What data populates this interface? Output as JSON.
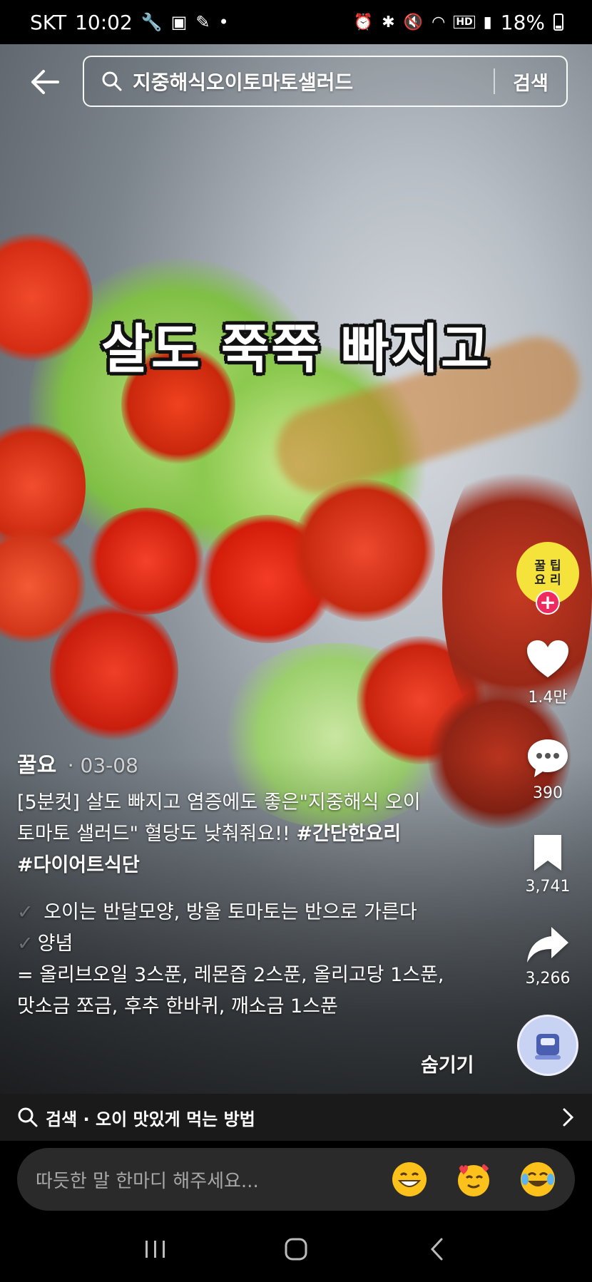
{
  "status_bar": {
    "carrier": "SKT",
    "time": "10:02",
    "battery": "18%"
  },
  "header": {
    "search_query": "지중해식오이토마토샐러드",
    "search_button": "검색"
  },
  "video": {
    "caption_overlay": "살도 쭉쭉 빠지고"
  },
  "creator": {
    "avatar_text": "꿀 팁\n요 리",
    "follow": "+"
  },
  "actions": {
    "likes": "1.4만",
    "comments": "390",
    "saves": "3,741",
    "shares": "3,266"
  },
  "post": {
    "author": "꿀요",
    "date": "· 03-08",
    "desc_line1": "[5분컷] 살도 빠지고 염증에도 좋은\"지중해식 오이",
    "desc_line2": "토마토 샐러드\" 혈당도 낮춰줘요!! ",
    "hashtag1": "#간단한요리",
    "hashtag2": "#다이어트식단",
    "step1": "오이는 반달모양, 방울 토마토는 반으로 가른다",
    "step2": "양념",
    "step3": "= 올리브오일 3스푼, 레몬즙 2스푼, 올리고당 1스푼,",
    "step4": "맛소금 쪼금, 후추 한바퀴, 깨소금 1스푼",
    "hide_label": "숨기기"
  },
  "search_suggestion": {
    "label": "검색 · 오이 맛있게 먹는 방법"
  },
  "comment": {
    "placeholder": "따듯한 말 한마디 해주세요..."
  },
  "colors": {
    "follow_red": "#ee2a5f",
    "avatar_yellow": "#f5e23a",
    "comment_bg": "#2a2a2a"
  }
}
